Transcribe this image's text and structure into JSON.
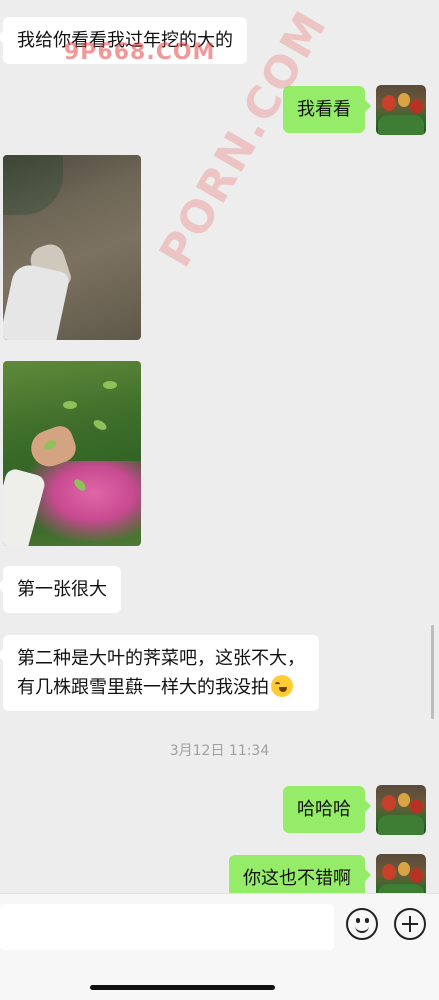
{
  "messages": [
    {
      "side": "left",
      "text": "我给你看看我过年挖的大的"
    },
    {
      "side": "right",
      "text": "我看看"
    },
    {
      "side": "left",
      "type": "image",
      "label": "photo-1"
    },
    {
      "side": "left",
      "type": "image",
      "label": "photo-2"
    },
    {
      "side": "left",
      "text": "第一张很大"
    },
    {
      "side": "left",
      "line1": "第二种是大叶的荠菜吧，这张不大，",
      "line2": "有几株跟雪里蕻一样大的我没拍",
      "emoji": "grinning-sweat-emoji"
    },
    {
      "side": "right",
      "text": "哈哈哈"
    },
    {
      "side": "right",
      "text": "你这也不错啊"
    }
  ],
  "timestamp": "3月12日 11:34",
  "watermark": {
    "top": "9P668.COM",
    "diagonal": "PORN.COM"
  },
  "input": {
    "placeholder": ""
  },
  "icons": {
    "emoji_button": "smile-icon",
    "more_button": "plus-icon"
  },
  "colors": {
    "background": "#ededed",
    "left_bubble": "#ffffff",
    "right_bubble": "#95ec69"
  }
}
